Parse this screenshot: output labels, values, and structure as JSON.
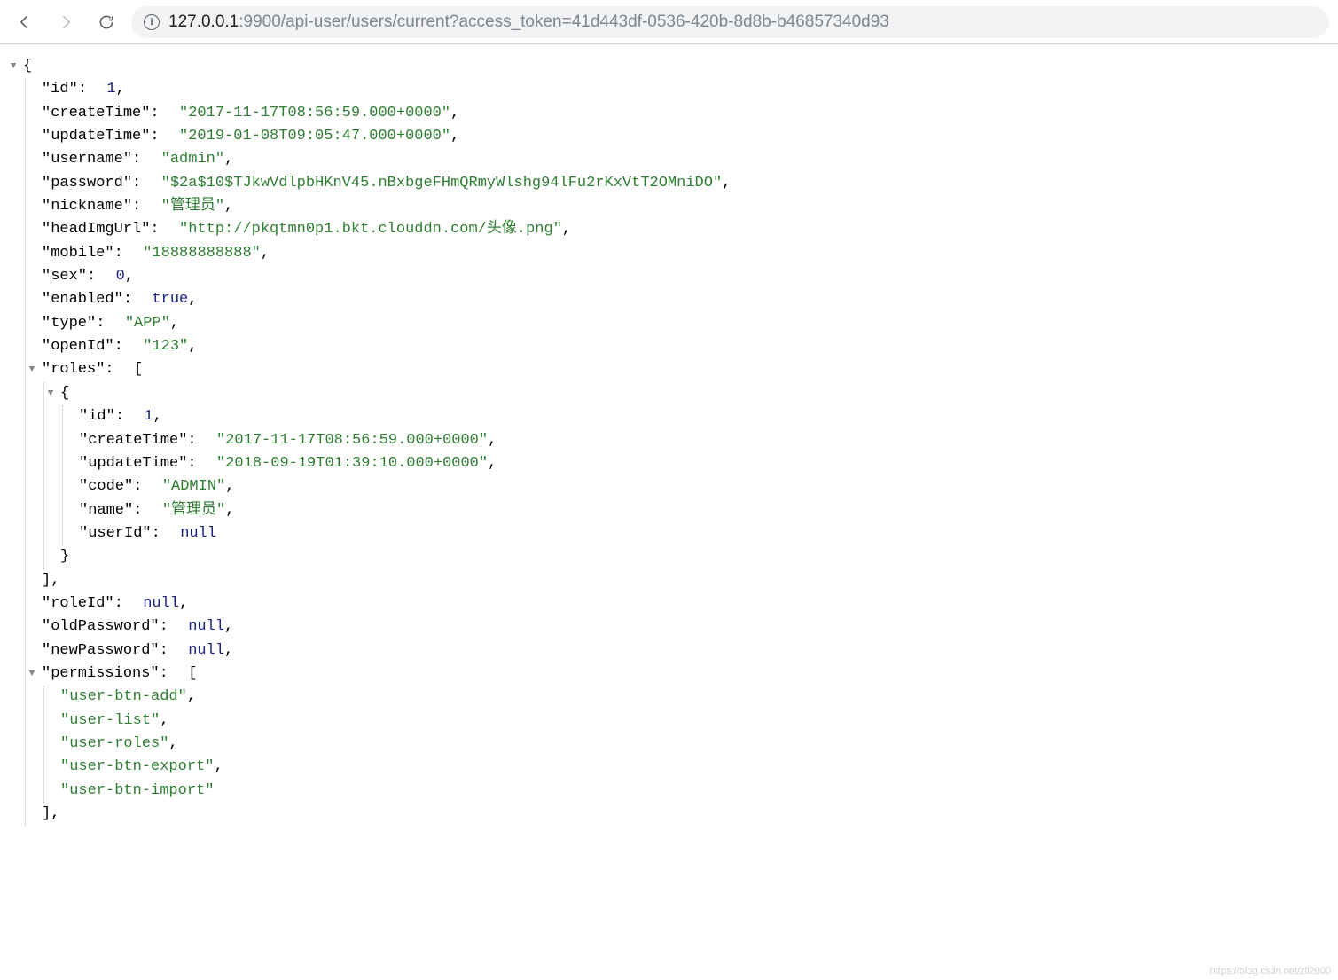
{
  "browser": {
    "url_host": "127.0.0.1",
    "url_rest": ":9900/api-user/users/current?access_token=41d443df-0536-420b-8d8b-b46857340d93"
  },
  "json": {
    "id_key": "\"id\"",
    "id_val": "1",
    "createTime_key": "\"createTime\"",
    "createTime_val": "\"2017-11-17T08:56:59.000+0000\"",
    "updateTime_key": "\"updateTime\"",
    "updateTime_val": "\"2019-01-08T09:05:47.000+0000\"",
    "username_key": "\"username\"",
    "username_val": "\"admin\"",
    "password_key": "\"password\"",
    "password_val": "\"$2a$10$TJkwVdlpbHKnV45.nBxbgeFHmQRmyWlshg94lFu2rKxVtT2OMniDO\"",
    "nickname_key": "\"nickname\"",
    "nickname_val": "\"管理员\"",
    "headImgUrl_key": "\"headImgUrl\"",
    "headImgUrl_val": "\"http://pkqtmn0p1.bkt.clouddn.com/头像.png\"",
    "mobile_key": "\"mobile\"",
    "mobile_val": "\"18888888888\"",
    "sex_key": "\"sex\"",
    "sex_val": "0",
    "enabled_key": "\"enabled\"",
    "enabled_val": "true",
    "type_key": "\"type\"",
    "type_val": "\"APP\"",
    "openId_key": "\"openId\"",
    "openId_val": "\"123\"",
    "roles_key": "\"roles\"",
    "roles_open": "[",
    "role_obj_open": "{",
    "role_id_key": "\"id\"",
    "role_id_val": "1",
    "role_createTime_key": "\"createTime\"",
    "role_createTime_val": "\"2017-11-17T08:56:59.000+0000\"",
    "role_updateTime_key": "\"updateTime\"",
    "role_updateTime_val": "\"2018-09-19T01:39:10.000+0000\"",
    "role_code_key": "\"code\"",
    "role_code_val": "\"ADMIN\"",
    "role_name_key": "\"name\"",
    "role_name_val": "\"管理员\"",
    "role_userId_key": "\"userId\"",
    "role_userId_val": "null",
    "role_obj_close": "}",
    "roles_close": "],",
    "roleId_key": "\"roleId\"",
    "roleId_val": "null",
    "oldPassword_key": "\"oldPassword\"",
    "oldPassword_val": "null",
    "newPassword_key": "\"newPassword\"",
    "newPassword_val": "null",
    "permissions_key": "\"permissions\"",
    "permissions_open": "[",
    "perm_0": "\"user-btn-add\"",
    "perm_1": "\"user-list\"",
    "perm_2": "\"user-roles\"",
    "perm_3": "\"user-btn-export\"",
    "perm_4": "\"user-btn-import\"",
    "permissions_close": "],"
  },
  "punct": {
    "brace_open": "{",
    "comma": ","
  },
  "watermark": "https://blog.csdn.net/zll2000"
}
